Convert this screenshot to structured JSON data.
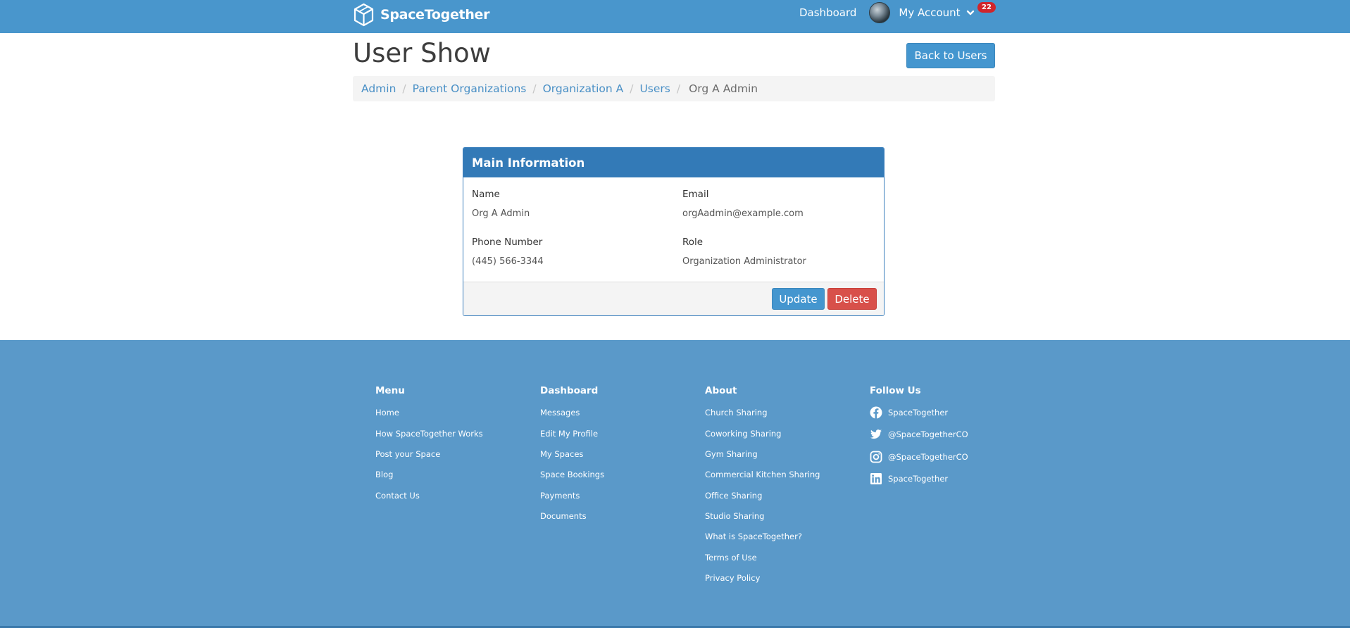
{
  "navbar": {
    "brand": "SpaceTogether",
    "dashboard_link": "Dashboard",
    "account_label": "My Account",
    "notification_count": "22"
  },
  "header": {
    "title": "User Show",
    "back_button": "Back to Users"
  },
  "breadcrumb": {
    "items": [
      "Admin",
      "Parent Organizations",
      "Organization A",
      "Users"
    ],
    "active": "Org A Admin"
  },
  "panel": {
    "heading": "Main Information",
    "fields": [
      {
        "label": "Name",
        "value": "Org A Admin"
      },
      {
        "label": "Email",
        "value": "orgAadmin@example.com"
      },
      {
        "label": "Phone Number",
        "value": "(445) 566-3344"
      },
      {
        "label": "Role",
        "value": "Organization Administrator"
      }
    ],
    "update_button": "Update",
    "delete_button": "Delete"
  },
  "footer": {
    "menu": {
      "title": "Menu",
      "links": [
        "Home",
        "How SpaceTogether Works",
        "Post your Space",
        "Blog",
        "Contact Us"
      ]
    },
    "dashboard": {
      "title": "Dashboard",
      "links": [
        "Messages",
        "Edit My Profile",
        "My Spaces",
        "Space Bookings",
        "Payments",
        "Documents"
      ]
    },
    "about": {
      "title": "About",
      "links": [
        "Church Sharing",
        "Coworking Sharing",
        "Gym Sharing",
        "Commercial Kitchen Sharing",
        "Office Sharing",
        "Studio Sharing",
        "What is SpaceTogether?",
        "Terms of Use",
        "Privacy Policy"
      ]
    },
    "follow": {
      "title": "Follow Us",
      "links": [
        {
          "icon": "facebook-icon",
          "label": "SpaceTogether"
        },
        {
          "icon": "twitter-icon",
          "label": "@SpaceTogetherCO"
        },
        {
          "icon": "instagram-icon",
          "label": "@SpaceTogetherCO"
        },
        {
          "icon": "linkedin-icon",
          "label": "SpaceTogether"
        }
      ]
    }
  },
  "colors": {
    "navbar": "#4996cc",
    "panel_heading": "#337ab7",
    "primary_button": "#4496cf",
    "danger_button": "#d8504a",
    "footer": "#5a99c9",
    "badge": "#d0252b"
  }
}
